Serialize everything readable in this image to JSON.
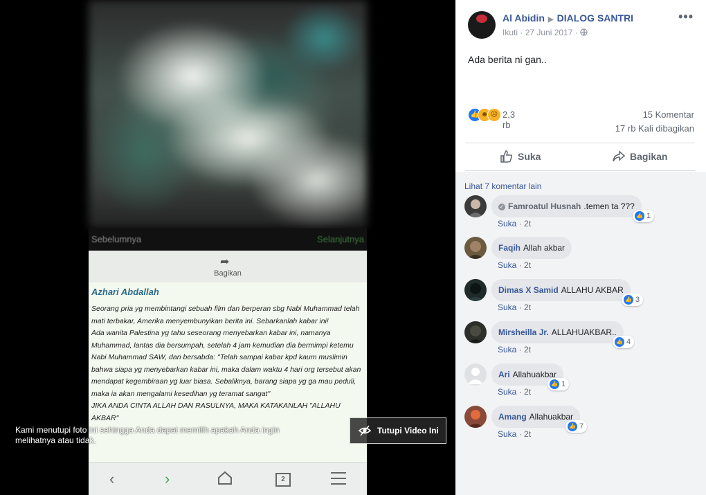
{
  "media": {
    "nav_prev": "Sebelumnya",
    "nav_next": "Selanjutnya",
    "share_label": "Bagikan",
    "author": "Azhari Abdallah",
    "paragraphs": [
      "Seorang pria yg membintangi sebuah film dan berperan sbg Nabi Muhammad telah mati terbakar, Amerika menyembunyikan berita ini. Sebarkanlah kabar ini!",
      "Ada wanita Palestina yg tahu seseorang menyebarkan kabar ini, namanya Muhammad, lantas dia bersumpah, setelah 4 jam kemudian dia bermimpi ketemu Nabi Muhammad SAW, dan bersabda: \"Telah sampai kabar kpd kaum muslimin bahwa siapa yg menyebarkan kabar ini, maka dalam waktu 4 hari org tersebut akan mendapat kegembiraan yg luar biasa. Sebaliknya, barang siapa yg ga mau peduli, maka ia akan mengalami kesedihan yg teramat sangat\"",
      "JIKA ANDA CINTA ALLAH DAN RASULNYA, MAKA KATAKANLAH \"ALLAHU AKBAR\""
    ],
    "tabs_count": "2",
    "overlay_message": "Kami menutupi foto ini sehingga Anda dapat memilih apakah Anda ingin melihatnya atau tidak.",
    "cover_button": "Tutupi Video Ini"
  },
  "post": {
    "author": "Al Abidin",
    "group": "DIALOG SANTRI",
    "follow": "Ikuti",
    "date": "27 Juni 2017",
    "text": "Ada berita ni gan..",
    "reaction_count": "2,3 rb",
    "comments_count": "15 Komentar",
    "shares_count": "17 rb Kali dibagikan",
    "like_label": "Suka",
    "share_label": "Bagikan",
    "more_comments": "Lihat 7 komentar lain"
  },
  "comments": [
    {
      "name": "Famroatul Husnah",
      "text": ".temen ta ???",
      "like": "Suka",
      "time": "2t",
      "reactions": "1",
      "avatar_color": "#3b3b3b"
    },
    {
      "name": "Faqih",
      "text": "Allah akbar",
      "like": "Suka",
      "time": "2t",
      "reactions": "",
      "avatar_color": "#6b5a3e"
    },
    {
      "name": "Dimas X Samid",
      "text": "ALLAHU AKBAR",
      "like": "Suka",
      "time": "2t",
      "reactions": "3",
      "avatar_color": "#1f2a2a"
    },
    {
      "name": "Mirsheilla Jr.",
      "text": "ALLAHUAKBAR..",
      "like": "Suka",
      "time": "2t",
      "reactions": "4",
      "avatar_color": "#2c2f2a"
    },
    {
      "name": "Ari",
      "text": "Allahuakbar",
      "like": "Suka",
      "time": "2t",
      "reactions": "1",
      "avatar_color": "#dfe1e4"
    },
    {
      "name": "Amang",
      "text": "Allahuakbar",
      "like": "Suka",
      "time": "2t",
      "reactions": "7",
      "avatar_color": "#8a4a3a"
    }
  ],
  "colors": {
    "link": "#385898",
    "like_blue": "#2078f4",
    "reaction_yellow": "#f7b125"
  }
}
